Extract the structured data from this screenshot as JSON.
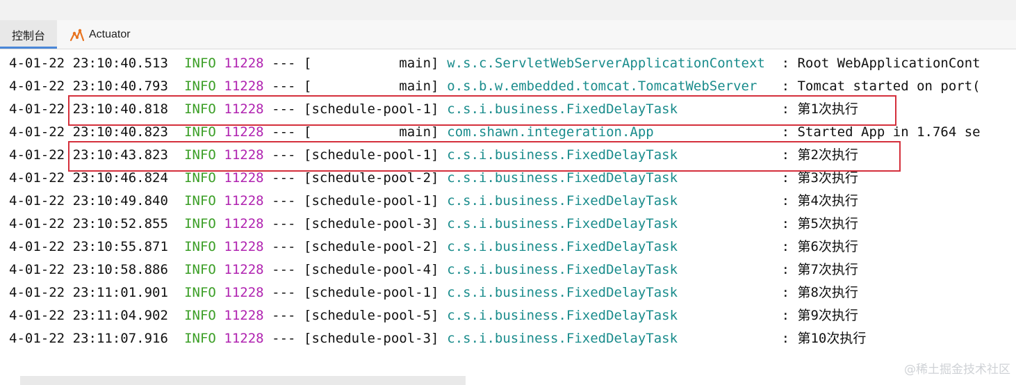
{
  "tabs": [
    {
      "label": "控制台",
      "active": true
    },
    {
      "label": "Actuator",
      "active": false,
      "icon": "actuator-icon"
    }
  ],
  "log": {
    "columns": [
      "date",
      "time",
      "level",
      "pid",
      "sep",
      "thread",
      "logger",
      "message"
    ],
    "lines": [
      {
        "date": "4-01-22",
        "time": "23:10:40.513",
        "level": "INFO",
        "pid": "11228",
        "sep": "---",
        "thread": "[           main]",
        "logger": "w.s.c.ServletWebServerApplicationContext",
        "message": ": Root WebApplicationCont"
      },
      {
        "date": "4-01-22",
        "time": "23:10:40.793",
        "level": "INFO",
        "pid": "11228",
        "sep": "---",
        "thread": "[           main]",
        "logger": "o.s.b.w.embedded.tomcat.TomcatWebServer",
        "message": ": Tomcat started on port("
      },
      {
        "date": "4-01-22",
        "time": "23:10:40.818",
        "level": "INFO",
        "pid": "11228",
        "sep": "---",
        "thread": "[schedule-pool-1]",
        "logger": "c.s.i.business.FixedDelayTask",
        "message": ": 第1次执行"
      },
      {
        "date": "4-01-22",
        "time": "23:10:40.823",
        "level": "INFO",
        "pid": "11228",
        "sep": "---",
        "thread": "[           main]",
        "logger": "com.shawn.integeration.App",
        "message": ": Started App in 1.764 se"
      },
      {
        "date": "4-01-22",
        "time": "23:10:43.823",
        "level": "INFO",
        "pid": "11228",
        "sep": "---",
        "thread": "[schedule-pool-1]",
        "logger": "c.s.i.business.FixedDelayTask",
        "message": ": 第2次执行"
      },
      {
        "date": "4-01-22",
        "time": "23:10:46.824",
        "level": "INFO",
        "pid": "11228",
        "sep": "---",
        "thread": "[schedule-pool-2]",
        "logger": "c.s.i.business.FixedDelayTask",
        "message": ": 第3次执行"
      },
      {
        "date": "4-01-22",
        "time": "23:10:49.840",
        "level": "INFO",
        "pid": "11228",
        "sep": "---",
        "thread": "[schedule-pool-1]",
        "logger": "c.s.i.business.FixedDelayTask",
        "message": ": 第4次执行"
      },
      {
        "date": "4-01-22",
        "time": "23:10:52.855",
        "level": "INFO",
        "pid": "11228",
        "sep": "---",
        "thread": "[schedule-pool-3]",
        "logger": "c.s.i.business.FixedDelayTask",
        "message": ": 第5次执行"
      },
      {
        "date": "4-01-22",
        "time": "23:10:55.871",
        "level": "INFO",
        "pid": "11228",
        "sep": "---",
        "thread": "[schedule-pool-2]",
        "logger": "c.s.i.business.FixedDelayTask",
        "message": ": 第6次执行"
      },
      {
        "date": "4-01-22",
        "time": "23:10:58.886",
        "level": "INFO",
        "pid": "11228",
        "sep": "---",
        "thread": "[schedule-pool-4]",
        "logger": "c.s.i.business.FixedDelayTask",
        "message": ": 第7次执行"
      },
      {
        "date": "4-01-22",
        "time": "23:11:01.901",
        "level": "INFO",
        "pid": "11228",
        "sep": "---",
        "thread": "[schedule-pool-1]",
        "logger": "c.s.i.business.FixedDelayTask",
        "message": ": 第8次执行"
      },
      {
        "date": "4-01-22",
        "time": "23:11:04.902",
        "level": "INFO",
        "pid": "11228",
        "sep": "---",
        "thread": "[schedule-pool-5]",
        "logger": "c.s.i.business.FixedDelayTask",
        "message": ": 第9次执行"
      },
      {
        "date": "4-01-22",
        "time": "23:11:07.916",
        "level": "INFO",
        "pid": "11228",
        "sep": "---",
        "thread": "[schedule-pool-3]",
        "logger": "c.s.i.business.FixedDelayTask",
        "message": ": 第10次执行"
      }
    ],
    "highlighted_line_indexes": [
      2,
      4
    ]
  },
  "watermark": "@稀土掘金技术社区",
  "colors": {
    "level": "#3a9e25",
    "pid": "#b023b0",
    "logger": "#1a8c8c",
    "highlight_box": "#d42f3b",
    "active_tab_underline": "#4a87d8"
  }
}
